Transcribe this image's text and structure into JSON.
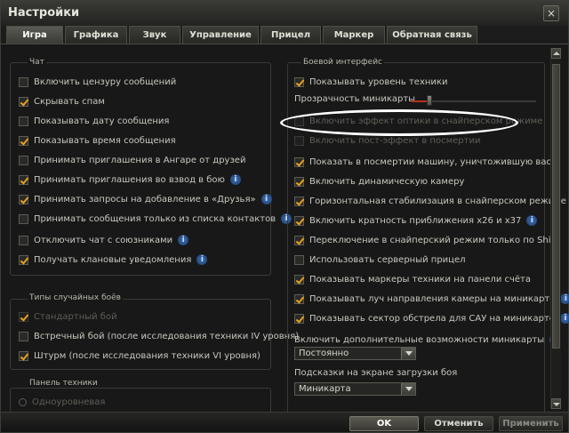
{
  "window": {
    "title": "Настройки",
    "close_label": "×"
  },
  "tabs": [
    {
      "label": "Игра",
      "active": true
    },
    {
      "label": "Графика",
      "active": false
    },
    {
      "label": "Звук",
      "active": false
    },
    {
      "label": "Управление",
      "active": false
    },
    {
      "label": "Прицел",
      "active": false
    },
    {
      "label": "Маркер",
      "active": false
    },
    {
      "label": "Обратная связь",
      "active": false
    }
  ],
  "chat": {
    "title": "Чат",
    "items": [
      {
        "label": "Включить цензуру сообщений",
        "checked": false,
        "info": false
      },
      {
        "label": "Скрывать спам",
        "checked": true,
        "info": false
      },
      {
        "label": "Показывать дату сообщения",
        "checked": false,
        "info": false
      },
      {
        "label": "Показывать время сообщения",
        "checked": true,
        "info": false
      },
      {
        "label": "Принимать приглашения в Ангаре от друзей",
        "checked": false,
        "info": false
      },
      {
        "label": "Принимать приглашения во взвод в бою",
        "checked": true,
        "info": true
      },
      {
        "label": "Принимать запросы на добавление в «Друзья»",
        "checked": true,
        "info": true
      },
      {
        "label": "Принимать сообщения только из списка контактов",
        "checked": false,
        "info": true
      },
      {
        "label": "Отключить чат с союзниками",
        "checked": false,
        "info": true
      },
      {
        "label": "Получать клановые уведомления",
        "checked": true,
        "info": true
      }
    ]
  },
  "battle_types": {
    "title": "Типы случайных боёв",
    "items": [
      {
        "label": "Стандартный бой",
        "checked": true,
        "disabled": true
      },
      {
        "label": "Встречный бой (после исследования техники IV уровня)",
        "checked": false,
        "disabled": false
      },
      {
        "label": "Штурм (после исследования техники VI уровня)",
        "checked": true,
        "disabled": false
      }
    ]
  },
  "vehicle_panel": {
    "title": "Панель техники",
    "option": "Одноуровневая"
  },
  "battle_ui": {
    "title": "Боевой интерфейс",
    "show_tech_level": {
      "label": "Показывать уровень техники",
      "checked": true
    },
    "minimap_transparency": {
      "label": "Прозрачность миникарты",
      "value": 0.14
    },
    "items": [
      {
        "label": "Включить эффект оптики в снайперском режиме",
        "checked": false,
        "disabled": true,
        "info": false
      },
      {
        "label": "Включить пост-эффект в посмертии",
        "checked": false,
        "disabled": true,
        "info": false
      },
      {
        "label": "Показать в посмертии машину, уничтожившую вас",
        "checked": true,
        "disabled": false,
        "info": false
      },
      {
        "label": "Включить динамическую камеру",
        "checked": true,
        "disabled": false,
        "info": false
      },
      {
        "label": "Горизонтальная стабилизация в снайперском режиме",
        "checked": true,
        "disabled": false,
        "info": false
      },
      {
        "label": "Включить кратность приближения x26 и x37",
        "checked": true,
        "disabled": false,
        "info": true
      },
      {
        "label": "Переключение в снайперский режим только по Shift",
        "checked": true,
        "disabled": false,
        "info": false
      },
      {
        "label": "Использовать серверный прицел",
        "checked": false,
        "disabled": false,
        "info": false
      },
      {
        "label": "Показывать маркеры техники на панели счёта",
        "checked": true,
        "disabled": false,
        "info": false
      },
      {
        "label": "Показывать луч направления камеры на миникарте",
        "checked": true,
        "disabled": false,
        "info": true
      },
      {
        "label": "Показывать сектор обстрела для САУ на миникарте",
        "checked": true,
        "disabled": false,
        "info": true
      }
    ],
    "minimap_extra": {
      "label": "Включить дополнительные возможности миникарты",
      "value": "Постоянно"
    },
    "loading_hints": {
      "label": "Подсказки на экране загрузки боя",
      "value": "Миникарта"
    }
  },
  "footer": {
    "ok": "OK",
    "cancel": "Отменить",
    "apply": "Применить"
  },
  "colors": {
    "accent": "#e8a020",
    "info": "#3a6fb0",
    "slider": "#b83020"
  }
}
